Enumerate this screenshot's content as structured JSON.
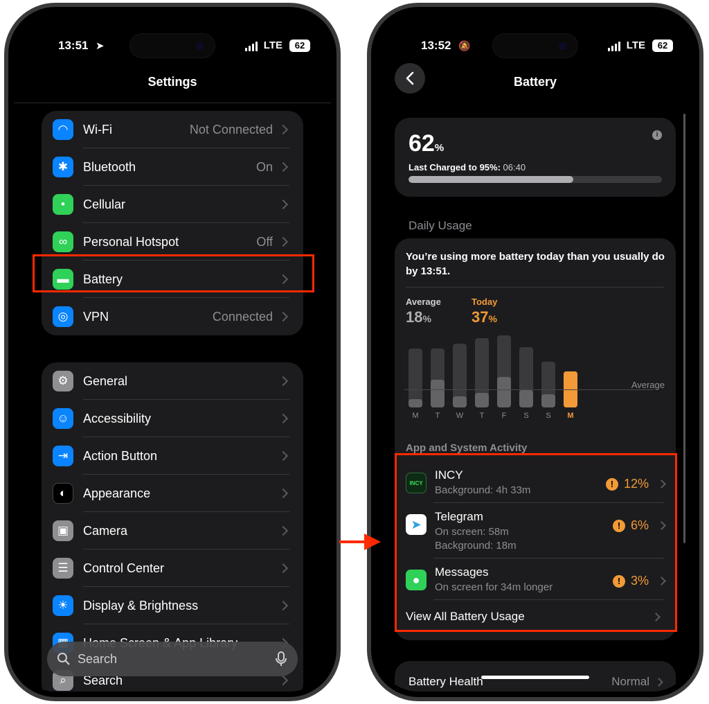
{
  "left": {
    "status": {
      "time": "13:51",
      "network": "LTE",
      "battery": "62"
    },
    "title": "Settings",
    "group1": [
      {
        "label": "Wi-Fi",
        "value": "Not Connected",
        "icon": "wifi-icon",
        "color": "#0a84ff"
      },
      {
        "label": "Bluetooth",
        "value": "On",
        "icon": "bluetooth-icon",
        "color": "#0a84ff"
      },
      {
        "label": "Cellular",
        "value": "",
        "icon": "cellular-icon",
        "color": "#30d158"
      },
      {
        "label": "Personal Hotspot",
        "value": "Off",
        "icon": "hotspot-icon",
        "color": "#30d158"
      },
      {
        "label": "Battery",
        "value": "",
        "icon": "battery-icon",
        "color": "#30d158"
      },
      {
        "label": "VPN",
        "value": "Connected",
        "icon": "globe-icon",
        "color": "#0a84ff"
      }
    ],
    "group2": [
      {
        "label": "General",
        "icon": "gear-icon",
        "color": "#8e8e93"
      },
      {
        "label": "Accessibility",
        "icon": "accessibility-icon",
        "color": "#0a84ff"
      },
      {
        "label": "Action Button",
        "icon": "action-button-icon",
        "color": "#0a84ff"
      },
      {
        "label": "Appearance",
        "icon": "appearance-icon",
        "color": "#000000"
      },
      {
        "label": "Camera",
        "icon": "camera-icon",
        "color": "#8e8e93"
      },
      {
        "label": "Control Center",
        "icon": "control-center-icon",
        "color": "#8e8e93"
      },
      {
        "label": "Display & Brightness",
        "icon": "sun-icon",
        "color": "#0a84ff"
      },
      {
        "label": "Home Screen & App Library",
        "icon": "home-screen-icon",
        "color": "#0a84ff"
      },
      {
        "label": "Search",
        "icon": "search-icon",
        "color": "#8e8e93"
      }
    ],
    "search_placeholder": "Search"
  },
  "right": {
    "status": {
      "time": "13:52",
      "network": "LTE",
      "battery": "62"
    },
    "title": "Battery",
    "level": {
      "value": "62",
      "unit": "%",
      "last_charged_label": "Last Charged to 95%:",
      "last_charged_time": "06:40",
      "fill": 0.65
    },
    "daily_usage_header": "Daily Usage",
    "insight": "You’re using more battery today than you usually do by 13:51.",
    "average": {
      "label": "Average",
      "value": "18",
      "unit": "%"
    },
    "today": {
      "label": "Today",
      "value": "37",
      "unit": "%"
    },
    "chart_avg_label": "Average",
    "days": [
      "M",
      "T",
      "W",
      "T",
      "F",
      "S",
      "S",
      "M"
    ],
    "day_totals": [
      0.82,
      0.82,
      0.88,
      0.96,
      1.0,
      0.84,
      0.63,
      0.5
    ],
    "day_active": [
      0.12,
      0.38,
      0.15,
      0.2,
      0.42,
      0.24,
      0.18,
      0.5
    ],
    "activity_header": "App and System Activity",
    "apps": [
      {
        "name": "INCY",
        "sub1": "Background: 4h 33m",
        "sub2": "",
        "pct": "12%",
        "icon": "incy-icon"
      },
      {
        "name": "Telegram",
        "sub1": "On screen: 58m",
        "sub2": "Background: 18m",
        "pct": "6%",
        "icon": "telegram-icon"
      },
      {
        "name": "Messages",
        "sub1": "On screen for 34m longer",
        "sub2": "",
        "pct": "3%",
        "icon": "messages-icon"
      }
    ],
    "view_all": "View All Battery Usage",
    "health": {
      "label": "Battery Health",
      "value": "Normal"
    }
  },
  "colors": {
    "accent_orange": "#f19a37",
    "highlight_red": "#ff2a00"
  }
}
